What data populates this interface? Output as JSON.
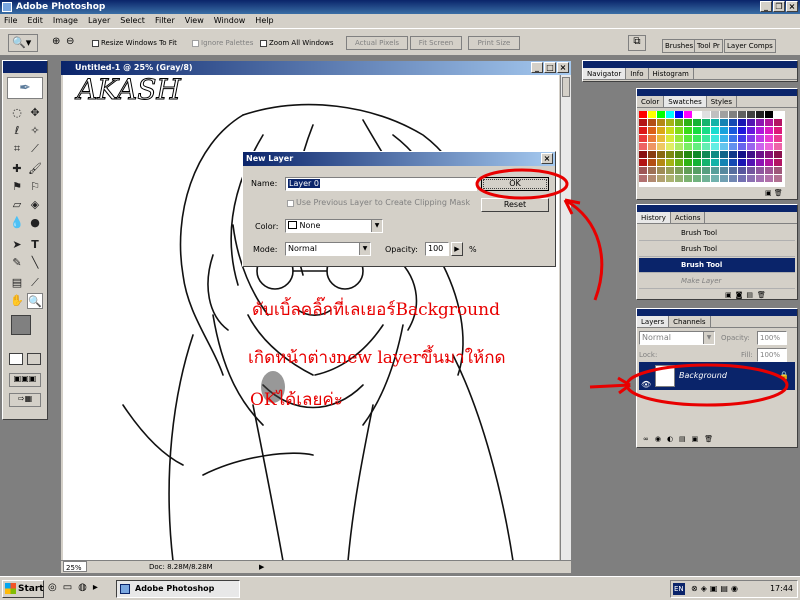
{
  "window": {
    "title": "Adobe Photoshop"
  },
  "menu": [
    "File",
    "Edit",
    "Image",
    "Layer",
    "Select",
    "Filter",
    "View",
    "Window",
    "Help"
  ],
  "options": {
    "resize_windows": "Resize Windows To Fit",
    "ignore_palettes": "Ignore Palettes",
    "zoom_all_windows": "Zoom All Windows",
    "actual_pixels": "Actual Pixels",
    "fit_screen": "Fit Screen",
    "print_size": "Print Size",
    "palette_well": [
      "Brushes",
      "Tool Pr",
      "Layer Comps"
    ]
  },
  "document": {
    "title": "Untitled-1 @ 25% (Gray/8)",
    "zoom": "25%",
    "doc_size": "Doc: 8.28M/8.28M"
  },
  "dialog": {
    "title": "New Layer",
    "name_label": "Name:",
    "name_value": "Layer 0",
    "clipping_label": "Use Previous Layer to Create Clipping Mask",
    "color_label": "Color:",
    "color_value": "None",
    "mode_label": "Mode:",
    "mode_value": "Normal",
    "opacity_label": "Opacity:",
    "opacity_value": "100",
    "opacity_unit": "%",
    "ok": "OK",
    "cancel": "Reset"
  },
  "navigator": {
    "tabs": [
      "Navigator",
      "Info",
      "Histogram"
    ]
  },
  "swatches": {
    "tabs": [
      "Color",
      "Swatches",
      "Styles"
    ]
  },
  "history": {
    "tabs": [
      "History",
      "Actions"
    ],
    "items": [
      "Brush Tool",
      "Brush Tool",
      "Brush Tool",
      "Make Layer"
    ]
  },
  "layers": {
    "tabs": [
      "Layers",
      "Channels"
    ],
    "mode": "Normal",
    "opacity_label": "Opacity:",
    "opacity": "100%",
    "fill_label": "Fill:",
    "fill": "100%",
    "lock_label": "Lock:",
    "layer_name": "Background"
  },
  "annotation": {
    "line1": "ดับเบิ้ลคลิ๊กที่เลเยอร์Background",
    "line2": "เกิดหน้าต่างnew layerขึ้นมาให้กด",
    "line3": "OKได้เลยค่ะ"
  },
  "canvas_logo": "AKASH",
  "taskbar": {
    "start": "Start",
    "task": "Adobe Photoshop",
    "lang": "EN",
    "clock": "17:44"
  },
  "colors": {
    "accent": "#0a246a",
    "annotation": "#e80000"
  }
}
